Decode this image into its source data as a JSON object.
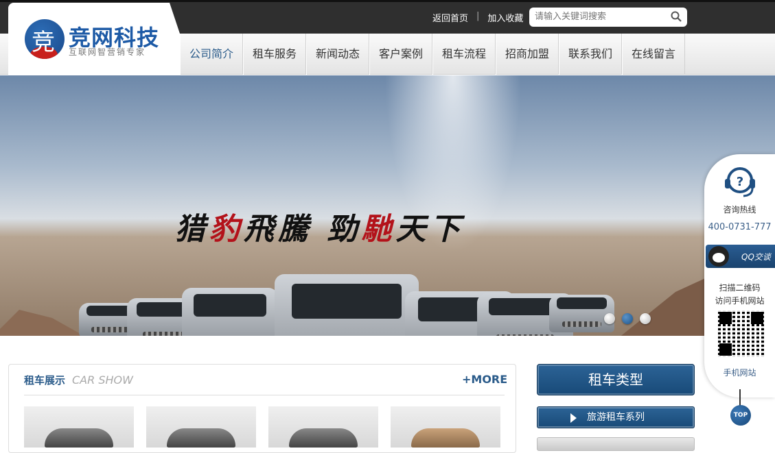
{
  "header": {
    "brand_name": "竞网科技",
    "brand_slogan": "互联网智营销专家",
    "logo_glyph": "竞",
    "links": {
      "home": "返回首页",
      "favorite": "加入收藏"
    },
    "search": {
      "placeholder": "请输入关键词搜索"
    }
  },
  "nav": {
    "items": [
      {
        "label": "公司简介"
      },
      {
        "label": "租车服务"
      },
      {
        "label": "新闻动态"
      },
      {
        "label": "客户案例"
      },
      {
        "label": "租车流程"
      },
      {
        "label": "招商加盟"
      },
      {
        "label": "联系我们"
      },
      {
        "label": "在线留言"
      }
    ],
    "active_index": 0
  },
  "banner": {
    "slogan_part1": "猎",
    "slogan_part2": "豹",
    "slogan_part3": "飛騰 勁",
    "slogan_part4": "馳",
    "slogan_part5": "天下",
    "slide_count": 3,
    "active_slide": 2
  },
  "side_panel": {
    "hotline_label": "咨询热线",
    "hotline_number": "400-0731-777",
    "qq_label": "QQ交谈",
    "scan_line1": "扫描二维码",
    "scan_line2": "访问手机网站",
    "mobile_label": "手机网站",
    "top_label": "TOP"
  },
  "car_show": {
    "title": "租车展示",
    "subtitle": "CAR SHOW",
    "more": "+MORE"
  },
  "rental_types": {
    "title": "租车类型",
    "items": [
      {
        "label": "旅游租车系列"
      }
    ]
  },
  "colors": {
    "brand_blue": "#1d5aa6",
    "nav_active": "#2a5b8a",
    "accent_red": "#c8201c",
    "topbar": "#2f2f2f"
  }
}
